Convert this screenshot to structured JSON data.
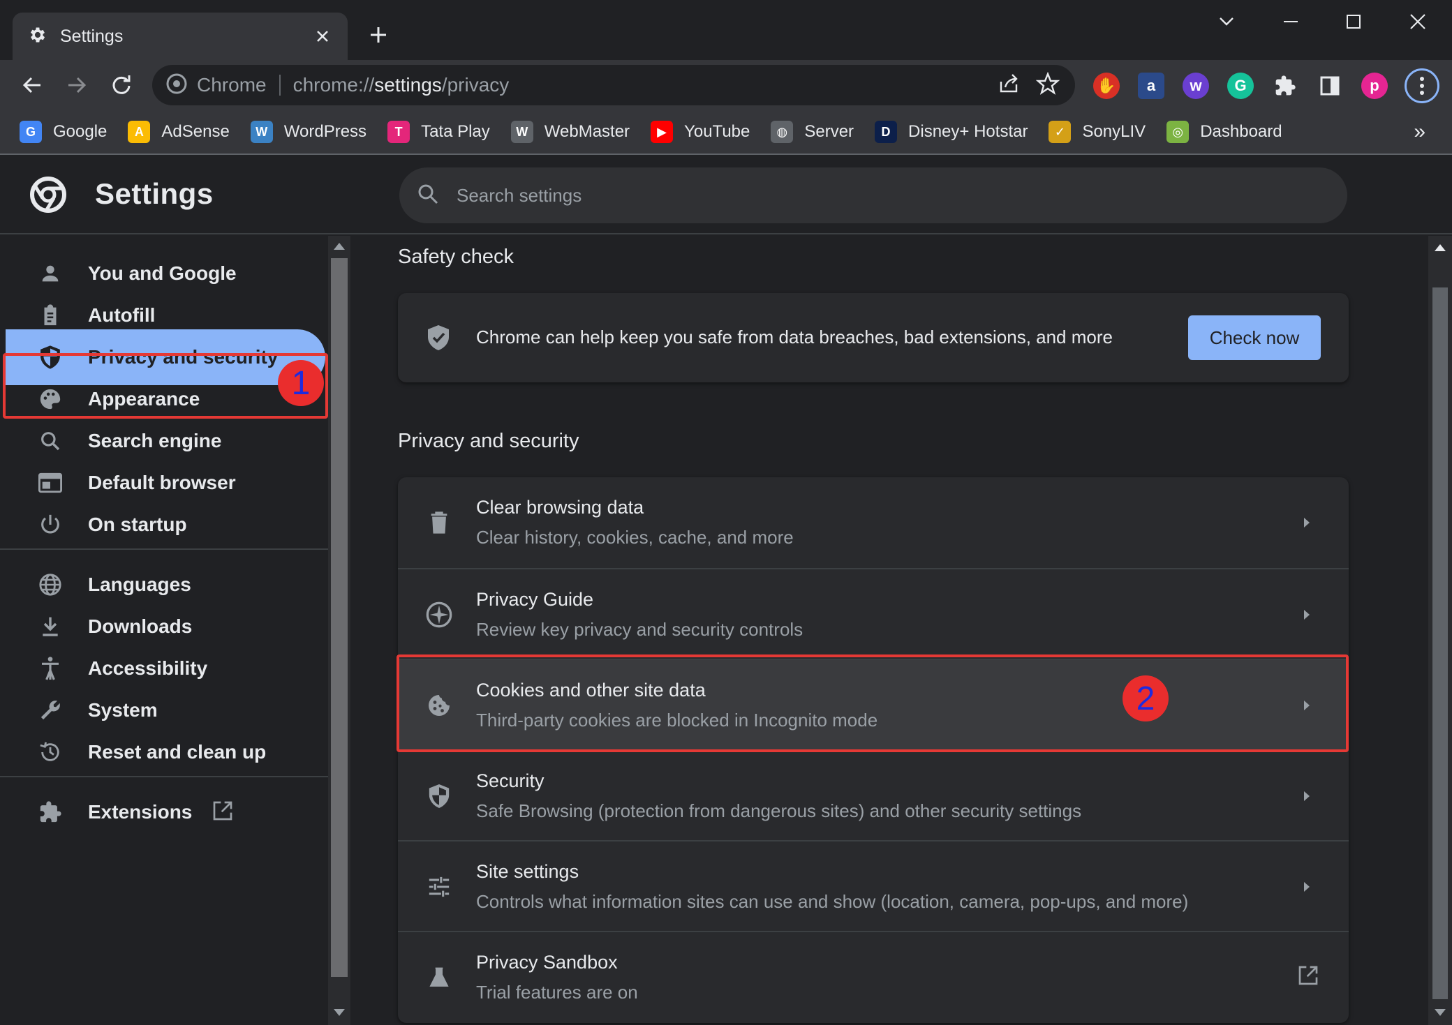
{
  "tab": {
    "title": "Settings"
  },
  "omnibox": {
    "brand": "Chrome",
    "scheme": "chrome://",
    "host": "settings",
    "path": "/privacy"
  },
  "bookmarks": [
    {
      "label": "Google",
      "icon": "google-icon",
      "color": "#4285f4",
      "glyph": "G"
    },
    {
      "label": "AdSense",
      "icon": "adsense-icon",
      "color": "#fbbc04",
      "glyph": "A"
    },
    {
      "label": "WordPress",
      "icon": "wordpress-icon",
      "color": "#3b82c4",
      "glyph": "W"
    },
    {
      "label": "Tata Play",
      "icon": "tataplay-icon",
      "color": "#e4267a",
      "glyph": "T"
    },
    {
      "label": "WebMaster",
      "icon": "webmaster-icon",
      "color": "#5f6368",
      "glyph": "W"
    },
    {
      "label": "YouTube",
      "icon": "youtube-icon",
      "color": "#ff0000",
      "glyph": "▶"
    },
    {
      "label": "Server",
      "icon": "globe-icon",
      "color": "#5f6368",
      "glyph": "◍"
    },
    {
      "label": "Disney+ Hotstar",
      "icon": "hotstar-icon",
      "color": "#0c1f4a",
      "glyph": "D"
    },
    {
      "label": "SonyLIV",
      "icon": "sonyliv-icon",
      "color": "#d4a017",
      "glyph": "✓"
    },
    {
      "label": "Dashboard",
      "icon": "dashboard-icon",
      "color": "#7cb342",
      "glyph": "◎"
    }
  ],
  "bookmarks_more": "»",
  "header": {
    "title": "Settings",
    "search_placeholder": "Search settings"
  },
  "sidebar": {
    "items": [
      {
        "label": "You and Google",
        "icon": "person-icon"
      },
      {
        "label": "Autofill",
        "icon": "clipboard-icon"
      },
      {
        "label": "Privacy and security",
        "icon": "shield-icon",
        "active": true
      },
      {
        "label": "Appearance",
        "icon": "palette-icon"
      },
      {
        "label": "Search engine",
        "icon": "search-icon"
      },
      {
        "label": "Default browser",
        "icon": "browser-icon"
      },
      {
        "label": "On startup",
        "icon": "power-icon"
      },
      {
        "label": "Languages",
        "icon": "globe-icon"
      },
      {
        "label": "Downloads",
        "icon": "download-icon"
      },
      {
        "label": "Accessibility",
        "icon": "accessibility-icon"
      },
      {
        "label": "System",
        "icon": "wrench-icon"
      },
      {
        "label": "Reset and clean up",
        "icon": "history-icon"
      },
      {
        "label": "Extensions",
        "icon": "puzzle-icon"
      }
    ]
  },
  "annotations": {
    "badge1": "1",
    "badge2": "2",
    "color": "#e53935"
  },
  "safety_check": {
    "title": "Safety check",
    "text": "Chrome can help keep you safe from data breaches, bad extensions, and more",
    "button": "Check now"
  },
  "privacy": {
    "title": "Privacy and security",
    "rows": [
      {
        "title": "Clear browsing data",
        "sub": "Clear history, cookies, cache, and more",
        "icon": "trash-icon"
      },
      {
        "title": "Privacy Guide",
        "sub": "Review key privacy and security controls",
        "icon": "compass-icon"
      },
      {
        "title": "Cookies and other site data",
        "sub": "Third-party cookies are blocked in Incognito mode",
        "icon": "cookie-icon"
      },
      {
        "title": "Security",
        "sub": "Safe Browsing (protection from dangerous sites) and other security settings",
        "icon": "shield-icon"
      },
      {
        "title": "Site settings",
        "sub": "Controls what information sites can use and show (location, camera, pop-ups, and more)",
        "icon": "tune-icon"
      },
      {
        "title": "Privacy Sandbox",
        "sub": "Trial features are on",
        "icon": "flask-icon"
      }
    ]
  },
  "colors": {
    "accent": "#8ab4f8",
    "background": "#202124",
    "card": "#292a2d"
  }
}
